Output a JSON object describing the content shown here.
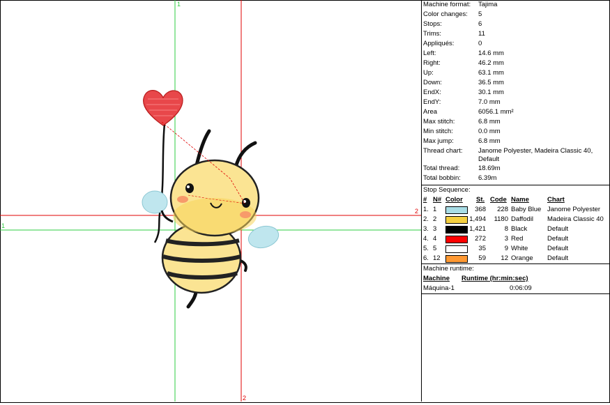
{
  "guides": {
    "green_label_top": "1",
    "green_label_left": "1",
    "red_label_right": "2",
    "red_label_bottom": "2"
  },
  "properties": [
    {
      "label": "Machine format:",
      "value": "Tajima"
    },
    {
      "label": "Color changes:",
      "value": "5"
    },
    {
      "label": "Stops:",
      "value": "6"
    },
    {
      "label": "Trims:",
      "value": "11"
    },
    {
      "label": "Appliqués:",
      "value": "0"
    },
    {
      "label": "Left:",
      "value": "14.6 mm"
    },
    {
      "label": "Right:",
      "value": "46.2 mm"
    },
    {
      "label": "Up:",
      "value": "63.1 mm"
    },
    {
      "label": "Down:",
      "value": "36.5 mm"
    },
    {
      "label": "EndX:",
      "value": "30.1 mm"
    },
    {
      "label": "EndY:",
      "value": "7.0 mm"
    },
    {
      "label": "Area",
      "value": "6056.1 mm²"
    },
    {
      "label": "Max stitch:",
      "value": "6.8 mm"
    },
    {
      "label": "Min stitch:",
      "value": "0.0 mm"
    },
    {
      "label": "Max jump:",
      "value": "6.8 mm"
    },
    {
      "label": "Thread chart:",
      "value": "Janome Polyester, Madeira Classic 40, Default"
    },
    {
      "label": "Total thread:",
      "value": "18.69m"
    },
    {
      "label": "Total bobbin:",
      "value": "6.39m"
    }
  ],
  "stop_sequence": {
    "title": "Stop Sequence:",
    "headers": {
      "num": "#",
      "n": "N#",
      "color": "Color",
      "st": "St.",
      "code": "Code",
      "name": "Name",
      "chart": "Chart"
    },
    "rows": [
      {
        "num": "1.",
        "n": "1",
        "swatch": "#a8dde6",
        "st": "368",
        "code": "228",
        "name": "Baby Blue",
        "chart": "Janome Polyester"
      },
      {
        "num": "2.",
        "n": "2",
        "swatch": "#f5d040",
        "st": "1,494",
        "code": "1180",
        "name": "Daffodil",
        "chart": "Madeira Classic 40"
      },
      {
        "num": "3.",
        "n": "3",
        "swatch": "#000000",
        "st": "1,421",
        "code": "8",
        "name": "Black",
        "chart": "Default"
      },
      {
        "num": "4.",
        "n": "4",
        "swatch": "#ff0000",
        "st": "272",
        "code": "3",
        "name": "Red",
        "chart": "Default"
      },
      {
        "num": "5.",
        "n": "5",
        "swatch": "#ffffff",
        "st": "35",
        "code": "9",
        "name": "White",
        "chart": "Default"
      },
      {
        "num": "6.",
        "n": "12",
        "swatch": "#ff9933",
        "st": "59",
        "code": "12",
        "name": "Orange",
        "chart": "Default"
      }
    ]
  },
  "runtime": {
    "title": "Machine runtime:",
    "col_machine": "Machine",
    "col_runtime": "Runtime (hr:min:sec)",
    "machine": "Máquina-1",
    "time": "0:06:09"
  }
}
